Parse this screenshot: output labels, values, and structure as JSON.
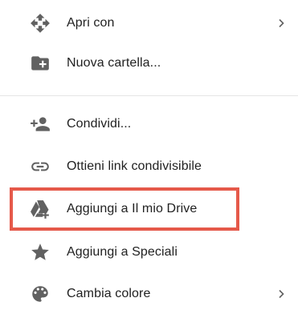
{
  "menu": {
    "items": [
      {
        "label": "Apri con",
        "icon": "move-arrows-icon",
        "submenu": true
      },
      {
        "label": "Nuova cartella...",
        "icon": "new-folder-icon",
        "submenu": false
      },
      {
        "label": "Condividi...",
        "icon": "person-add-icon",
        "submenu": false
      },
      {
        "label": "Ottieni link condivisibile",
        "icon": "link-icon",
        "submenu": false
      },
      {
        "label": "Aggiungi a Il mio Drive",
        "icon": "drive-add-icon",
        "submenu": false,
        "highlighted": true
      },
      {
        "label": "Aggiungi a Speciali",
        "icon": "star-icon",
        "submenu": false
      },
      {
        "label": "Cambia colore",
        "icon": "palette-icon",
        "submenu": true
      }
    ]
  },
  "colors": {
    "icon": "#616161",
    "highlight_border": "#e5594a",
    "divider": "#e5e5e5"
  }
}
